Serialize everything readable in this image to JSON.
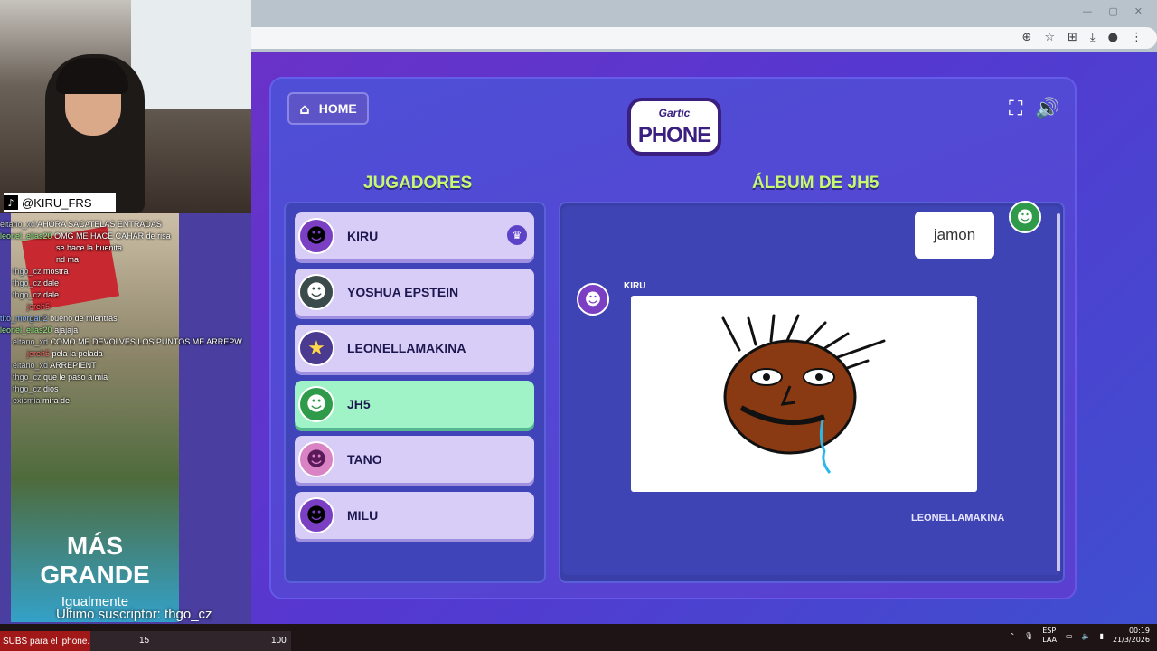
{
  "browser": {
    "window_controls": [
      "—",
      "▢",
      "✕"
    ],
    "toolbar_icons": [
      "zoom-icon",
      "star-icon",
      "translate-icon",
      "download-icon",
      "profile-icon",
      "menu-icon"
    ]
  },
  "game": {
    "home_label": "HOME",
    "logo_top": "Gartic",
    "logo_main": "PHONE",
    "players_title": "JUGADORES",
    "album_title": "ÁLBUM DE JH5",
    "players": [
      {
        "name": "KIRU",
        "host": true,
        "active": false,
        "avatar_color": "#7b3fc4"
      },
      {
        "name": "YOSHUA EPSTEIN",
        "host": false,
        "active": false,
        "avatar_color": "#3b4a4a"
      },
      {
        "name": "LEONELLAMAKINA",
        "host": false,
        "active": false,
        "avatar_color": "#4a3a90"
      },
      {
        "name": "JH5",
        "host": false,
        "active": true,
        "avatar_color": "#2f9b4a"
      },
      {
        "name": "TANO",
        "host": false,
        "active": false,
        "avatar_color": "#d982c4"
      },
      {
        "name": "MILU",
        "host": false,
        "active": false,
        "avatar_color": "#7b3fc4"
      }
    ],
    "album": {
      "phrase": "jamon",
      "drawer": "KIRU",
      "next_player": "LEONELLAMAKINA"
    }
  },
  "stream": {
    "tiktok_handle": "@KIRU_FRS",
    "chat": [
      {
        "user": "eltano_xd",
        "msg": "AHORA SACATELAS ENTRADAS"
      },
      {
        "user": "leonel_elias20",
        "msg": "OMG ME HACE CAHAR de risa"
      },
      {
        "user": "",
        "msg": "se hace la buenita"
      },
      {
        "user": "",
        "msg": "nd ma"
      },
      {
        "user": "thgo_cz",
        "msg": "mostra"
      },
      {
        "user": "thgo_cz",
        "msg": "dale"
      },
      {
        "user": "thgo_cz",
        "msg": "dale"
      },
      {
        "user": "jereh5",
        "msg": ""
      },
      {
        "user": "tito_morgan2",
        "msg": "bueno de mientras"
      },
      {
        "user": "leonel_elias20",
        "msg": "ajajaja"
      },
      {
        "user": "eltano_xd",
        "msg": "COMO ME DEVOLVES LOS PUNTOS ME ARREPW"
      },
      {
        "user": "jereh5",
        "msg": "pela la pelada"
      },
      {
        "user": "eltano_xd",
        "msg": "ARREPIENT"
      },
      {
        "user": "thgo_cz",
        "msg": "que le paso a mia"
      },
      {
        "user": "thgo_cz",
        "msg": "dios"
      },
      {
        "user": "exismia",
        "msg": "mira de"
      }
    ],
    "promo_big": "MÁS GRANDE",
    "promo_small": "Igualmente",
    "last_subscriber": "Ultimo suscriptor: thgo_cz",
    "subs_label": "SUBS para el iphone.",
    "subs_current": "15",
    "subs_goal": "100"
  },
  "taskbar": {
    "lang_top": "ESP",
    "lang_bottom": "LAA",
    "time": "00:19",
    "date": "21/3/2026"
  }
}
